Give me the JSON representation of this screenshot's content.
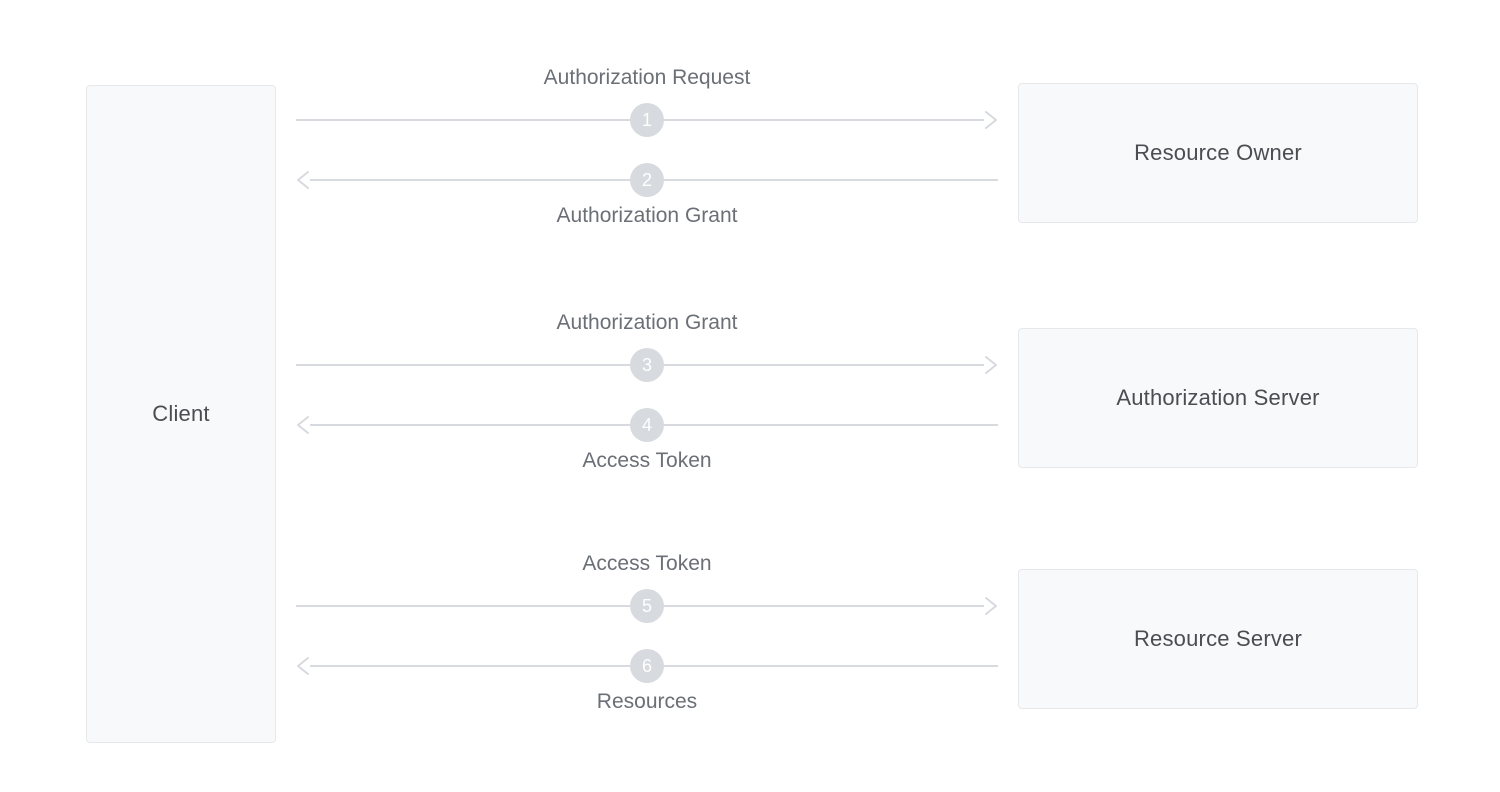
{
  "nodes": {
    "client": "Client",
    "resource_owner": "Resource Owner",
    "authorization_server": "Authorization Server",
    "resource_server": "Resource Server"
  },
  "flows": [
    {
      "step": "1",
      "label": "Authorization Request",
      "direction": "right",
      "label_position": "above"
    },
    {
      "step": "2",
      "label": "Authorization Grant",
      "direction": "left",
      "label_position": "below"
    },
    {
      "step": "3",
      "label": "Authorization Grant",
      "direction": "right",
      "label_position": "above"
    },
    {
      "step": "4",
      "label": "Access Token",
      "direction": "left",
      "label_position": "below"
    },
    {
      "step": "5",
      "label": "Access Token",
      "direction": "right",
      "label_position": "above"
    },
    {
      "step": "6",
      "label": "Resources",
      "direction": "left",
      "label_position": "below"
    }
  ]
}
